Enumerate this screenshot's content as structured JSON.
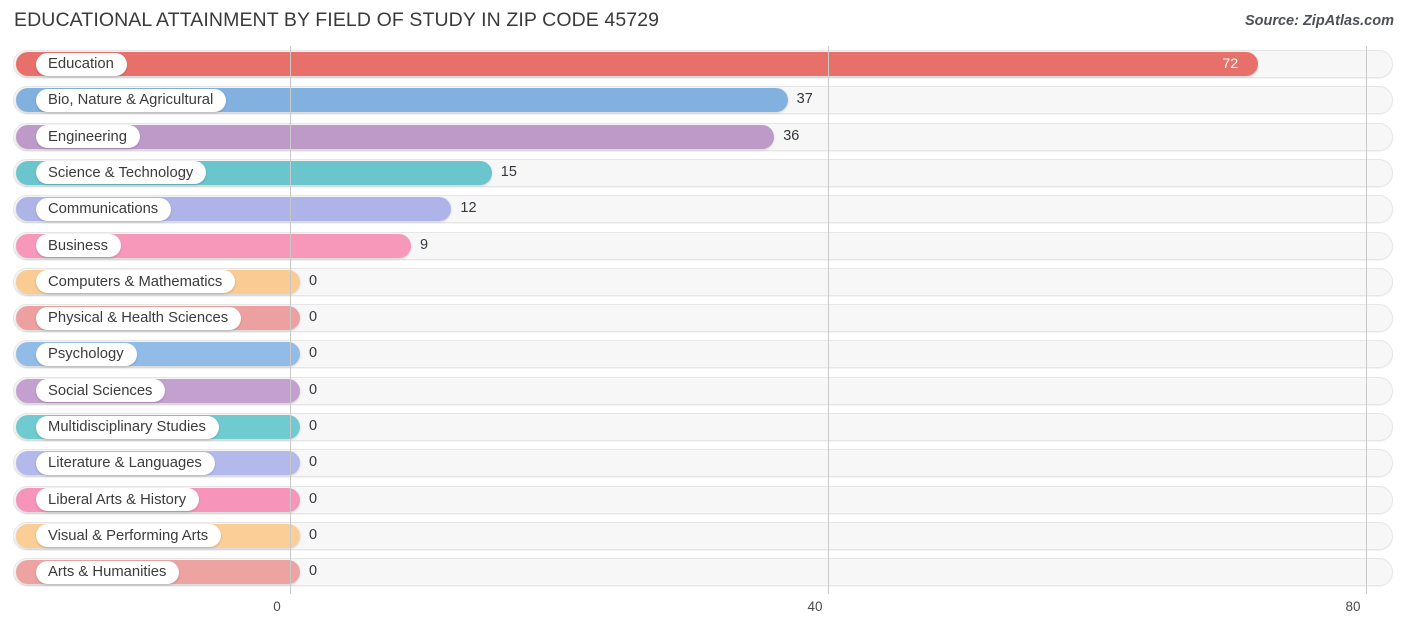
{
  "header": {
    "title": "EDUCATIONAL ATTAINMENT BY FIELD OF STUDY IN ZIP CODE 45729",
    "source": "Source: ZipAtlas.com"
  },
  "chart_data": {
    "type": "bar",
    "orientation": "horizontal",
    "title": "EDUCATIONAL ATTAINMENT BY FIELD OF STUDY IN ZIP CODE 45729",
    "subtitle": "Source: ZipAtlas.com",
    "xlabel": "",
    "ylabel": "",
    "xlim": [
      0,
      80
    ],
    "xticks": [
      0,
      40,
      80
    ],
    "xtick_labels": [
      "0",
      "40",
      "80"
    ],
    "grid": true,
    "legend": false,
    "categories": [
      "Education",
      "Bio, Nature & Agricultural",
      "Engineering",
      "Science & Technology",
      "Communications",
      "Business",
      "Computers & Mathematics",
      "Physical & Health Sciences",
      "Psychology",
      "Social Sciences",
      "Multidisciplinary Studies",
      "Literature & Languages",
      "Liberal Arts & History",
      "Visual & Performing Arts",
      "Arts & Humanities"
    ],
    "values": [
      72,
      37,
      36,
      15,
      12,
      9,
      0,
      0,
      0,
      0,
      0,
      0,
      0,
      0,
      0
    ],
    "value_labels": [
      "72",
      "37",
      "36",
      "15",
      "12",
      "9",
      "0",
      "0",
      "0",
      "0",
      "0",
      "0",
      "0",
      "0",
      "0"
    ],
    "colors": [
      "#e8706b",
      "#82b1e0",
      "#be9ac8",
      "#6ac6cc",
      "#afb4e8",
      "#f798bb",
      "#facb93",
      "#eda0a0",
      "#92bce8",
      "#c4a0d0",
      "#6fcbd0",
      "#b3b9ea",
      "#f794b9",
      "#fbcd97",
      "#eda3a1"
    ]
  }
}
